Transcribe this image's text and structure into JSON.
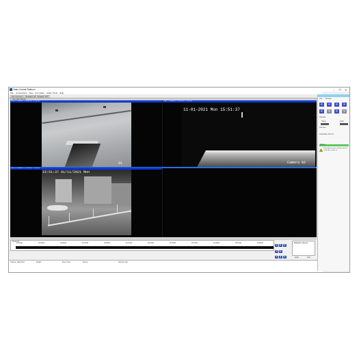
{
  "window": {
    "title": "Video Central Platinum",
    "controls": [
      "–",
      "❐",
      "✕"
    ]
  },
  "menu": [
    "File",
    "Connections",
    "View",
    "Live Video",
    "Audio",
    "Tools",
    "Help"
  ],
  "tabs": [
    "Site Overview",
    "Viewtech SAT",
    "Viewtech SAT"
  ],
  "toolbar": {
    "label": "New Main Display"
  },
  "cameras": [
    {
      "header": "Cam # 1 Camera 1 - 11/01/2021 - 15:51:36"
    },
    {
      "header": "Cam # 2 Camera 2 - 11/01/2021 - 15:51:36",
      "timestamp": "11-01-2021 Mon 15:51:37",
      "name": "Camera 02"
    },
    {
      "header": "Cam # 3 Camera 3 - 11/01/2021 - 15:51:36",
      "timestamp": "15:51:37 01/11/2021 Mon"
    }
  ],
  "feed1_label": "01",
  "timeline": {
    "date": "11-Jan-21",
    "ticks": [
      "15:31:00",
      "15:33:00",
      "15:35:00",
      "15:37:00",
      "15:39:00",
      "15:41:00",
      "15:43:00",
      "15:45:00",
      "15:47:00",
      "15:49:00",
      "15:51:00",
      "15:53:00"
    ],
    "side_label": "Playback to Events",
    "apply": "Apply",
    "auto": "Auto"
  },
  "events": {
    "columns": [
      "Camera",
      "Date/Time",
      "Details",
      "Event Type",
      "Source",
      "Detector Text"
    ]
  },
  "right_panel": {
    "tabs": [
      "Live",
      "Preview"
    ],
    "section": "Playback",
    "status_label": "Status",
    "audio_label": "Audio",
    "camera_label": "Camera 1",
    "playing": "Playing",
    "warning": "Depending on your network speed it could take a while to",
    "date": "11/01/2021 15:51:37"
  }
}
